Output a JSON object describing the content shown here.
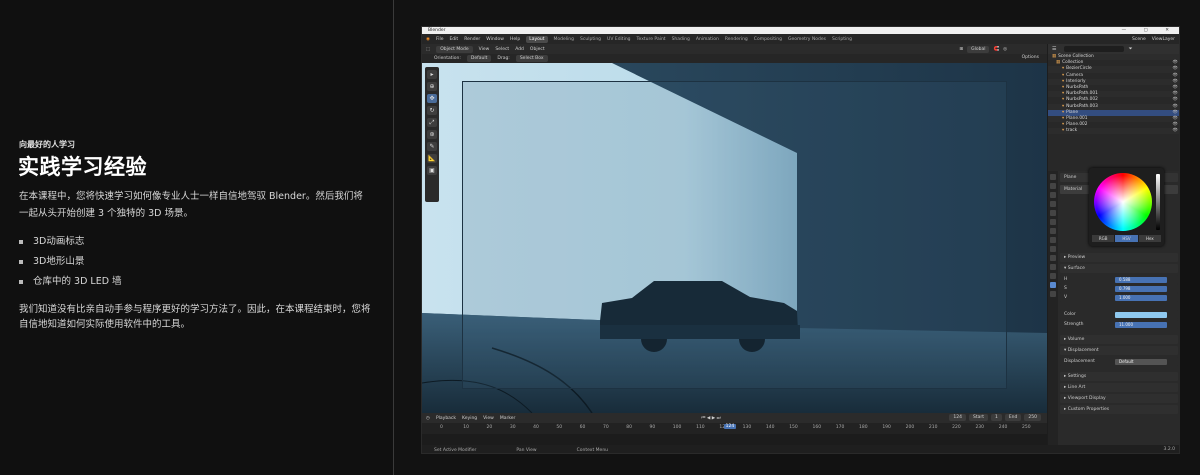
{
  "page": {
    "eyebrow": "向最好的人学习",
    "title": "实践学习经验",
    "description": "在本课程中，您将快速学习如何像专业人士一样自信地驾驭 Blender。然后我们将一起从头开始创建 3 个独特的 3D 场景。",
    "bullets": [
      "3D动画标志",
      "3D地形山景",
      "仓库中的 3D LED 墙"
    ],
    "description2": "我们知道没有比亲自动手参与程序更好的学习方法了。因此，在本课程结束时，您将自信地知道如何实际使用软件中的工具。"
  },
  "blender": {
    "window_title": "Blender",
    "menus": [
      "File",
      "Edit",
      "Render",
      "Window",
      "Help"
    ],
    "workspaces": [
      "Layout",
      "Modeling",
      "Sculpting",
      "UV Editing",
      "Texture Paint",
      "Shading",
      "Animation",
      "Rendering",
      "Compositing",
      "Geometry Nodes",
      "Scripting"
    ],
    "active_workspace": "Layout",
    "scene_label": "Scene",
    "view_layer_label": "ViewLayer",
    "header": {
      "mode": "Object Mode",
      "view": "View",
      "select": "Select",
      "add": "Add",
      "object": "Object",
      "transform": "Global"
    },
    "subheader": {
      "orientation_label": "Orientation:",
      "orientation_value": "Default",
      "drag_label": "Drag:",
      "drag_value": "Select Box",
      "options": "Options"
    },
    "outliner": {
      "root": "Scene Collection",
      "items": [
        "Collection",
        "BezierCircle",
        "Camera",
        "Interiorly",
        "NurbsPath",
        "NurbsPath.001",
        "NurbsPath.002",
        "NurbsPath.003",
        "Plane",
        "Plane.001",
        "Plane.002",
        "track"
      ],
      "selected": "Plane"
    },
    "properties": {
      "object_name": "Plane",
      "material_label": "Material",
      "preview": "Preview",
      "surface": "Surface",
      "color_label": "Color",
      "strength_label": "Strength",
      "strength_value": "11.000",
      "hsv_h": "0.588",
      "hsv_s": "0.798",
      "hsv_v": "1.000",
      "volume": "Volume",
      "displacement_section": "Displacement",
      "displacement_label": "Displacement",
      "displacement_value": "Default",
      "settings": "Settings",
      "line_art": "Line Art",
      "viewport_display": "Viewport Display",
      "custom_properties": "Custom Properties",
      "picker_modes": [
        "RGB",
        "HSV",
        "Hex"
      ],
      "picker_active": "HSV"
    },
    "timeline": {
      "playback": "Playback",
      "keying": "Keying",
      "view": "View",
      "marker": "Marker",
      "current_frame": "124",
      "start_label": "Start",
      "start_value": "1",
      "end_label": "End",
      "end_value": "250",
      "ticks": [
        "0",
        "10",
        "20",
        "30",
        "40",
        "50",
        "60",
        "70",
        "80",
        "90",
        "100",
        "110",
        "120",
        "130",
        "140",
        "150",
        "160",
        "170",
        "180",
        "190",
        "200",
        "210",
        "220",
        "230",
        "240",
        "250"
      ]
    },
    "status": {
      "left": "Set Active Modifier",
      "mid": "Pan View",
      "right": "Context Menu",
      "version": "3.2.0"
    },
    "colors": {
      "accent": "#4772b3",
      "panel": "#2a2a2a",
      "viewport": "#35546a"
    }
  }
}
